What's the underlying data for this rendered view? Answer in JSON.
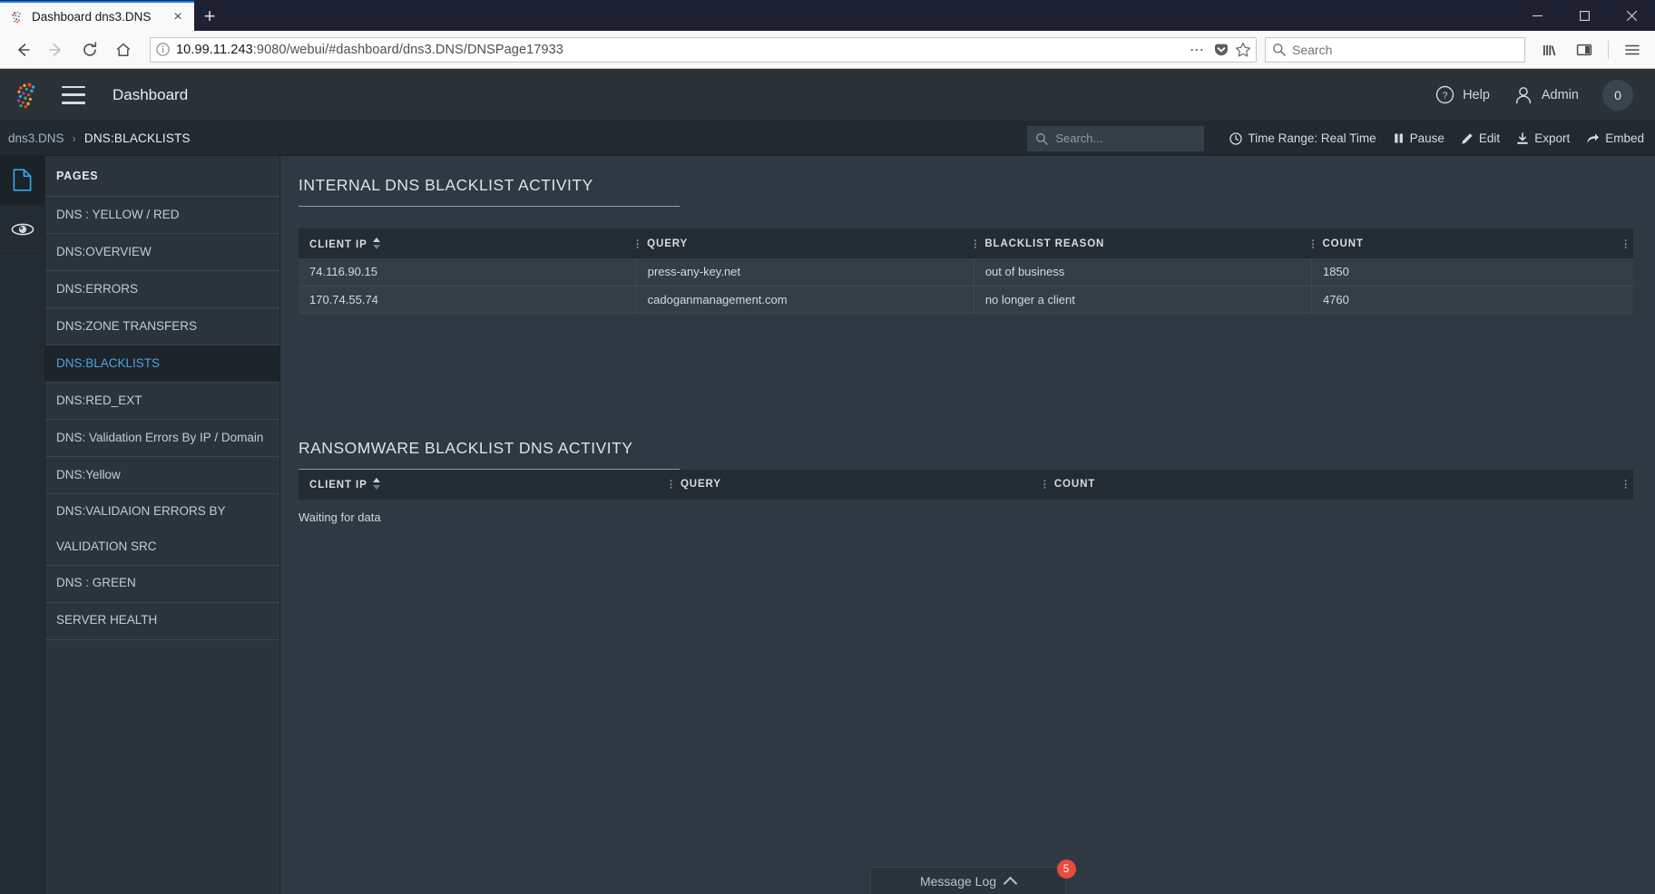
{
  "browser": {
    "tab": {
      "title": "Dashboard dns3.DNS",
      "favicon": "sagan-logo-icon",
      "close": "×"
    },
    "new_tab_label": "+",
    "window_controls": {
      "minimize": "─",
      "maximize": "☐",
      "close": "✕"
    },
    "nav": {
      "back": "back-arrow",
      "forward": "forward-arrow",
      "reload": "reload-icon",
      "home": "home-icon"
    },
    "url": {
      "info_icon": "info-icon",
      "host": "10.99.11.243",
      "rest": ":9080/webui/#dashboard/dns3.DNS/DNSPage17933",
      "full": "10.99.11.243:9080/webui/#dashboard/dns3.DNS/DNSPage17933"
    },
    "urlbar_actions": {
      "more": "⋯",
      "pocket": "pocket-icon",
      "bookmark": "star-icon"
    },
    "search": {
      "placeholder": "Search",
      "icon": "search-icon"
    },
    "toolbar_right": {
      "library": "library-icon",
      "sidebar": "sidebar-icon",
      "menu": "hamburger-menu-icon"
    }
  },
  "app_header": {
    "logo": "sagan-logo",
    "menu_icon": "hamburger-menu-icon",
    "title": "Dashboard",
    "help": {
      "label": "Help",
      "icon": "question-circle-icon"
    },
    "user": {
      "label": "Admin",
      "icon": "user-icon"
    },
    "notification_count": "0"
  },
  "breadcrumb": {
    "root": "dns3.DNS",
    "separator": "›",
    "current": "DNS:BLACKLISTS",
    "search_placeholder": "Search...",
    "tools": [
      {
        "label": "Time Range: Real Time",
        "icon": "clock-icon"
      },
      {
        "label": "Pause",
        "icon": "pause-icon"
      },
      {
        "label": "Edit",
        "icon": "pencil-icon"
      },
      {
        "label": "Export",
        "icon": "download-icon"
      },
      {
        "label": "Embed",
        "icon": "share-arrow-icon"
      }
    ]
  },
  "icon_rail": [
    {
      "name": "page-icon",
      "selected": true
    },
    {
      "name": "eye-icon",
      "selected": false
    }
  ],
  "sidebar": {
    "header": "PAGES",
    "items": [
      {
        "label": "DNS : YELLOW / RED",
        "active": false
      },
      {
        "label": "DNS:OVERVIEW",
        "active": false
      },
      {
        "label": "DNS:ERRORS",
        "active": false
      },
      {
        "label": "DNS:ZONE TRANSFERS",
        "active": false
      },
      {
        "label": "DNS:BLACKLISTS",
        "active": true
      },
      {
        "label": "DNS:RED_EXT",
        "active": false
      },
      {
        "label": "DNS: Validation Errors By IP / Domain",
        "active": false
      },
      {
        "label": "DNS:Yellow",
        "active": false
      },
      {
        "label": "DNS:VALIDAION ERRORS BY",
        "label2": "VALIDATION SRC",
        "active": false
      },
      {
        "label": "DNS : GREEN",
        "active": false
      },
      {
        "label": "SERVER HEALTH",
        "active": false
      }
    ]
  },
  "panels": [
    {
      "title": "INTERNAL DNS BLACKLIST ACTIVITY",
      "columns": [
        "CLIENT IP",
        "QUERY",
        "BLACKLIST REASON",
        "COUNT"
      ],
      "rows": [
        [
          "74.116.90.15",
          "press-any-key.net",
          "out of business",
          "1850"
        ],
        [
          "170.74.55.74",
          "cadoganmanagement.com",
          "no longer a client",
          "4760"
        ]
      ],
      "empty_text": ""
    },
    {
      "title": "RANSOMWARE BLACKLIST DNS ACTIVITY",
      "columns": [
        "CLIENT IP",
        "QUERY",
        "COUNT"
      ],
      "rows": [],
      "empty_text": "Waiting for data"
    }
  ],
  "message_log": {
    "label": "Message Log",
    "chevron": "chevron-up-icon",
    "count": "5"
  },
  "colors": {
    "accent": "#4ea3dd",
    "badge": "#e74c3c",
    "tab_accent": "#0a84ff",
    "app_bg": "#2f3943"
  }
}
